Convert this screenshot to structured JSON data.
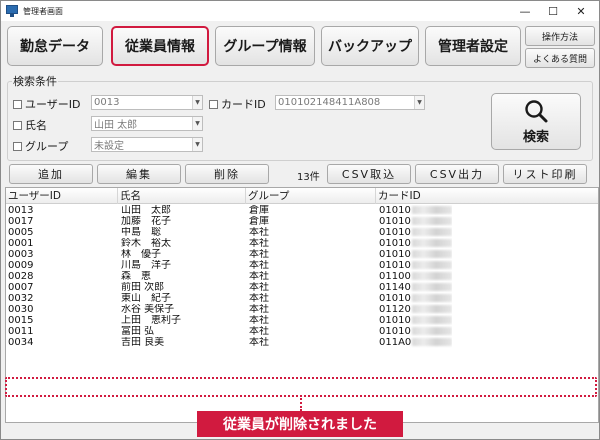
{
  "window": {
    "title": "管理者画面",
    "controls": {
      "minimize": "—",
      "maximize": "☐",
      "close": "✕"
    }
  },
  "nav": {
    "items": [
      {
        "label": "勤怠データ"
      },
      {
        "label": "従業員情報",
        "active": true
      },
      {
        "label": "グループ情報"
      },
      {
        "label": "バックアップ"
      },
      {
        "label": "管理者設定"
      }
    ],
    "help": "操作方法",
    "faq": "よくある質問"
  },
  "search": {
    "legend": "検索条件",
    "user_id": {
      "label": "ユーザーID",
      "value": "0013"
    },
    "card_id": {
      "label": "カードID",
      "value": "010102148411A808"
    },
    "name": {
      "label": "氏名",
      "value": "山田 太郎"
    },
    "group": {
      "label": "グループ",
      "value": "未設定"
    },
    "button_label": "検索"
  },
  "actions": {
    "add": "追加",
    "edit": "編集",
    "delete": "削除",
    "count": "13件",
    "csv_import": "CSV取込",
    "csv_export": "CSV出力",
    "list_print": "リスト印刷"
  },
  "table": {
    "columns": [
      "ユーザーID",
      "氏名",
      "グループ",
      "カードID"
    ],
    "rows": [
      {
        "id": "0013",
        "name": "山田　太郎",
        "group": "倉庫",
        "card": "01010"
      },
      {
        "id": "0017",
        "name": "加藤　花子",
        "group": "倉庫",
        "card": "01010"
      },
      {
        "id": "0005",
        "name": "中島　聡",
        "group": "本社",
        "card": "01010"
      },
      {
        "id": "0001",
        "name": "鈴木　裕太",
        "group": "本社",
        "card": "01010"
      },
      {
        "id": "0003",
        "name": "林　優子",
        "group": "本社",
        "card": "01010"
      },
      {
        "id": "0009",
        "name": "川島　洋子",
        "group": "本社",
        "card": "01010"
      },
      {
        "id": "0028",
        "name": "森　恵",
        "group": "本社",
        "card": "01100"
      },
      {
        "id": "0007",
        "name": "前田 次郎",
        "group": "本社",
        "card": "01140"
      },
      {
        "id": "0032",
        "name": "東山　紀子",
        "group": "本社",
        "card": "01010"
      },
      {
        "id": "0030",
        "name": "水谷 美保子",
        "group": "本社",
        "card": "01120"
      },
      {
        "id": "0015",
        "name": "上田　恵利子",
        "group": "本社",
        "card": "01010"
      },
      {
        "id": "0011",
        "name": "富田 弘",
        "group": "本社",
        "card": "01010"
      },
      {
        "id": "0034",
        "name": "吉田 良美",
        "group": "本社",
        "card": "011A0"
      }
    ]
  },
  "annotation": {
    "callout": "従業員が削除されました",
    "color": "#d11a3f"
  }
}
